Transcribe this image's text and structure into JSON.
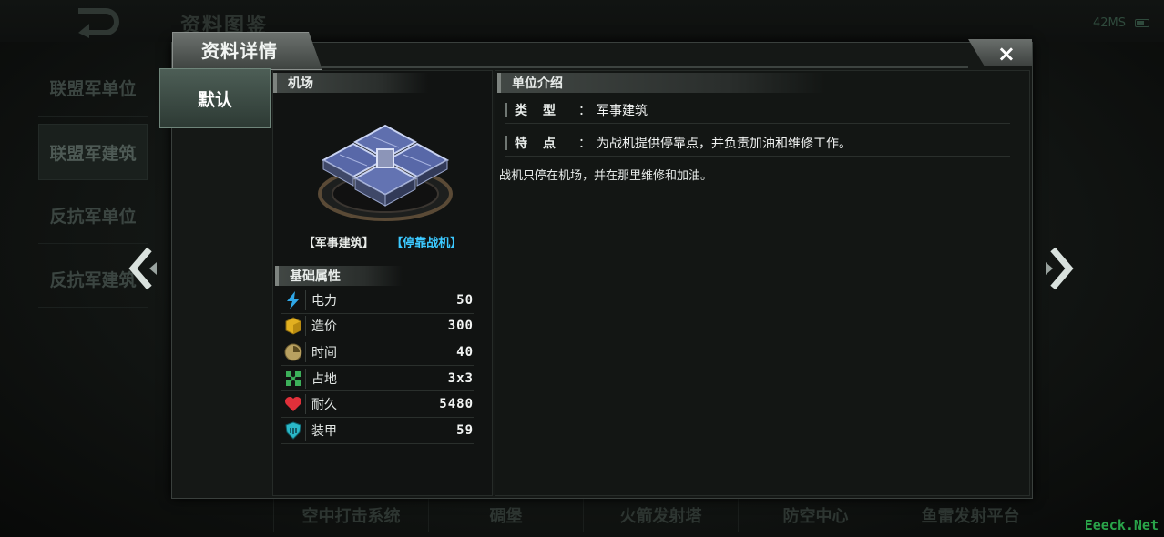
{
  "bg": {
    "title": "资料图鉴",
    "status_text": "42MS",
    "side_tabs": [
      "联盟军单位",
      "联盟军建筑",
      "反抗军单位",
      "反抗军建筑"
    ],
    "bottom_tabs": [
      "空中打击系统",
      "碉堡",
      "火箭发射塔",
      "防空中心",
      "鱼雷发射平台"
    ],
    "watermark": "Eeeck.Net"
  },
  "dialog": {
    "title": "资料详情",
    "close_label": "×",
    "skin_tab": "默认"
  },
  "unit": {
    "section_name": "机场",
    "type_tag": "【军事建筑】",
    "role_tag": "【停靠战机】",
    "stats_header": "基础属性",
    "stats": [
      {
        "icon": "lightning-icon",
        "label": "电力",
        "value": "50"
      },
      {
        "icon": "cube-icon",
        "label": "造价",
        "value": "300"
      },
      {
        "icon": "clock-icon",
        "label": "时间",
        "value": "40"
      },
      {
        "icon": "footprint-icon",
        "label": "占地",
        "value": "3x3"
      },
      {
        "icon": "heart-icon",
        "label": "耐久",
        "value": "5480"
      },
      {
        "icon": "armor-icon",
        "label": "装甲",
        "value": "59"
      }
    ]
  },
  "intro": {
    "header": "单位介绍",
    "type_key": "类型",
    "type_val": "军事建筑",
    "feature_key": "特点",
    "feature_val": "为战机提供停靠点，并负责加油和维修工作。",
    "desc": "战机只停在机场，并在那里维修和加油。"
  },
  "colors": {
    "accent": "#3cc9ff",
    "watermark": "#2aa44a"
  }
}
